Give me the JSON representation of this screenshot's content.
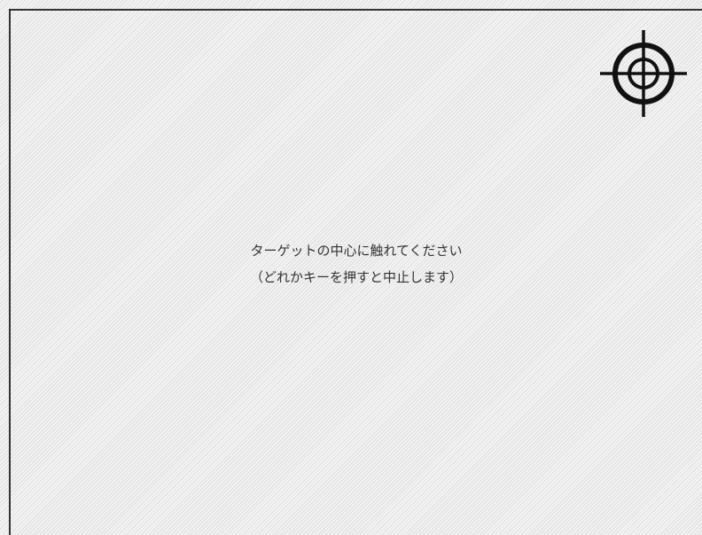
{
  "calibration": {
    "instruction_line1": "ターゲットの中心に触れてください",
    "instruction_line2": "（どれかキーを押すと中止します）",
    "target_icon": "crosshair-icon"
  },
  "colors": {
    "background": "#f3f3f3",
    "stripe": "#dcdcdc",
    "frame": "#333333",
    "target": "#111111",
    "text": "#333333"
  }
}
